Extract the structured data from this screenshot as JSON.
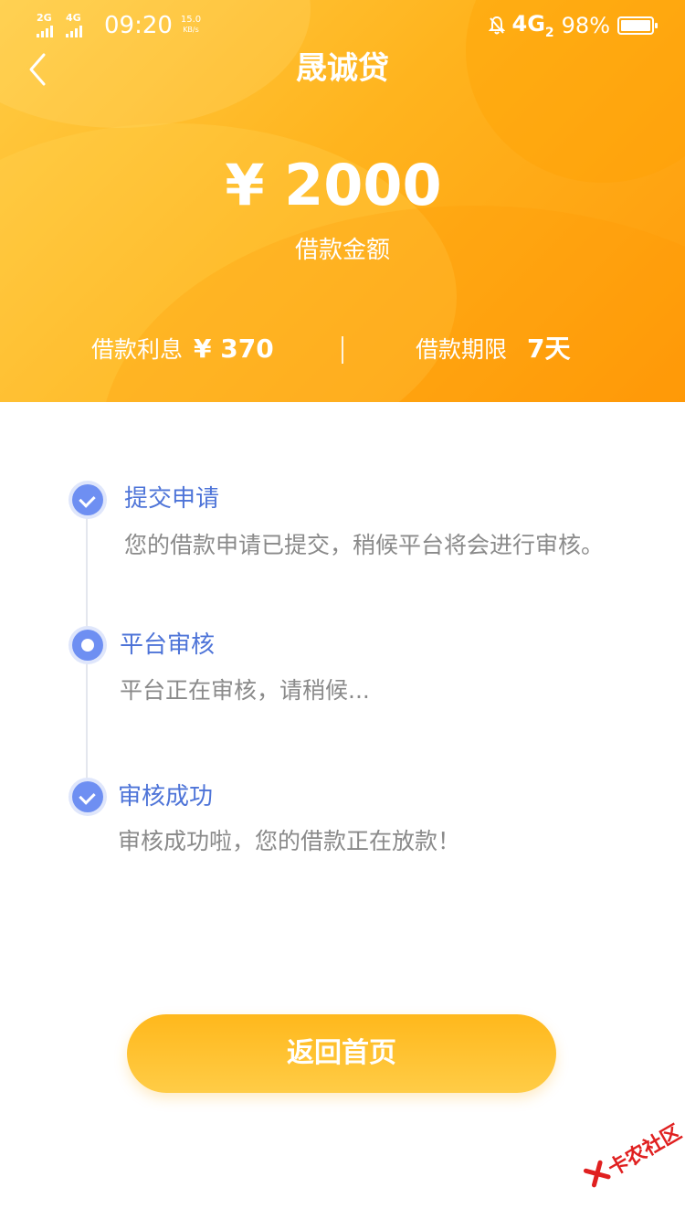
{
  "status_bar": {
    "sim1_label": "2G",
    "sim2_label": "4G",
    "time": "09:20",
    "speed_value": "15.0",
    "speed_unit": "KB/s",
    "network": "4G",
    "network_sub": "2",
    "battery": "98%",
    "battery_level": 0.98
  },
  "nav": {
    "title": "晟诚贷"
  },
  "loan": {
    "amount": "¥ 2000",
    "amount_label": "借款金额",
    "interest_label": "借款利息",
    "interest_value": "¥ 370",
    "term_label": "借款期限",
    "term_value": "7天"
  },
  "steps": [
    {
      "title": "提交申请",
      "desc": "您的借款申请已提交，稍候平台将会进行审核。",
      "state": "done"
    },
    {
      "title": "平台审核",
      "desc": "平台正在审核，请稍候...",
      "state": "current"
    },
    {
      "title": "审核成功",
      "desc": "审核成功啦，您的借款正在放款！",
      "state": "done"
    }
  ],
  "button": {
    "label": "返回首页"
  },
  "watermark": {
    "text": "卡农社区"
  },
  "colors": {
    "header_start": "#ffcc44",
    "header_end": "#ff9a0a",
    "accent_blue": "#6e8ff2",
    "button": "#ffb81c"
  }
}
